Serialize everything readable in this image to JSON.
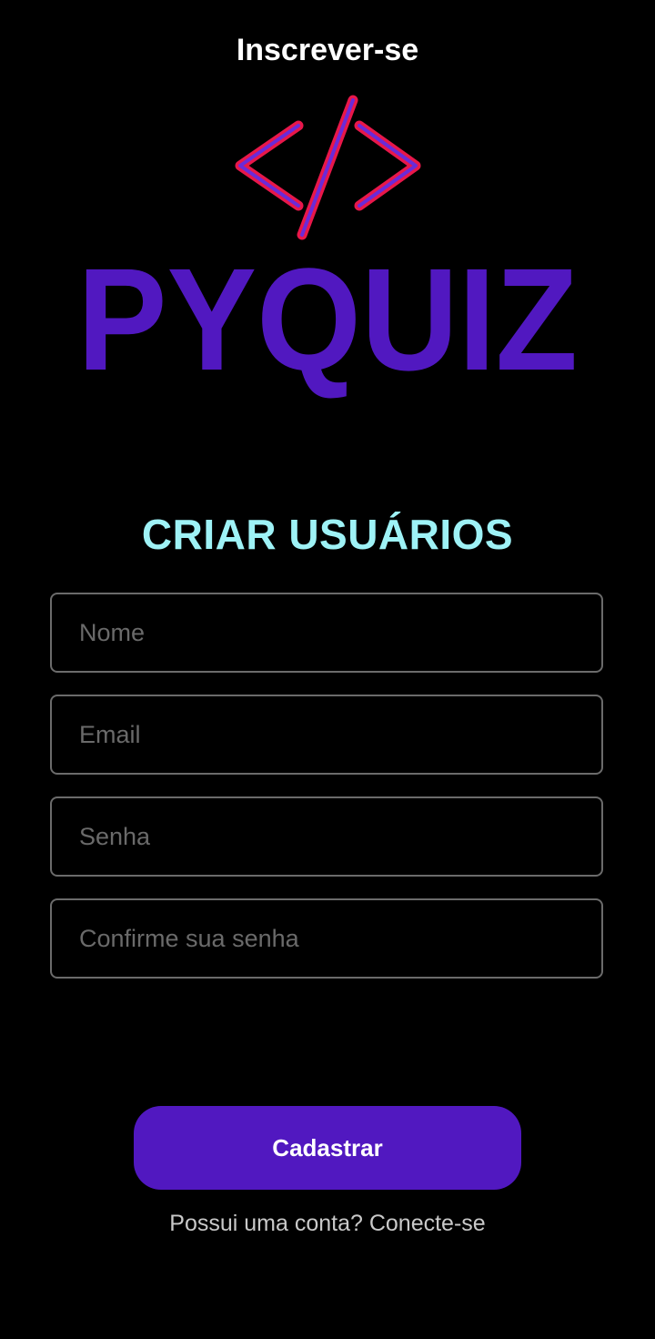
{
  "header": {
    "title": "Inscrever-se"
  },
  "logo": {
    "icon_name": "code-brackets-icon",
    "text": "PYQUIZ",
    "brand_color": "#5118c0",
    "icon_color": "#e8174a"
  },
  "form": {
    "title": "CRIAR USUÁRIOS",
    "title_color": "#9ef2f6",
    "fields": [
      {
        "placeholder": "Nome",
        "value": ""
      },
      {
        "placeholder": "Email",
        "value": ""
      },
      {
        "placeholder": "Senha",
        "value": ""
      },
      {
        "placeholder": "Confirme sua senha",
        "value": ""
      }
    ]
  },
  "actions": {
    "submit_label": "Cadastrar",
    "login_link": "Possui uma conta? Conecte-se"
  },
  "colors": {
    "background": "#000000",
    "button": "#5118c0",
    "field_border": "#6b6b6b"
  }
}
